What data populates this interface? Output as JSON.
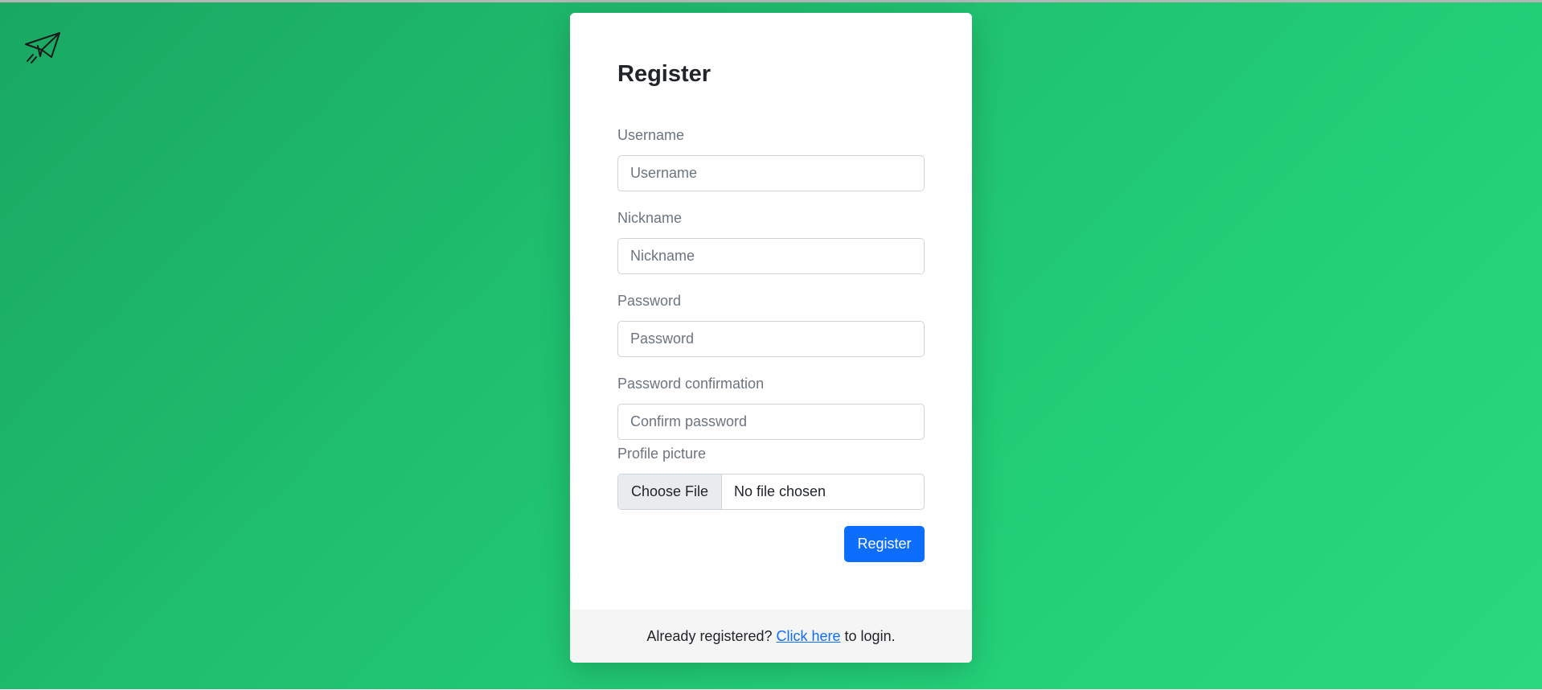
{
  "brand": {
    "icon": "paper-plane-icon"
  },
  "form": {
    "title": "Register",
    "username": {
      "label": "Username",
      "placeholder": "Username",
      "value": ""
    },
    "nickname": {
      "label": "Nickname",
      "placeholder": "Nickname",
      "value": ""
    },
    "password": {
      "label": "Password",
      "placeholder": "Password",
      "value": ""
    },
    "password_confirmation": {
      "label": "Password confirmation",
      "placeholder": "Confirm password",
      "value": ""
    },
    "profile_picture": {
      "label": "Profile picture",
      "button_label": "Choose File",
      "status": "No file chosen"
    },
    "submit_label": "Register"
  },
  "footer": {
    "prefix": "Already registered?",
    "link_text": "Click here",
    "suffix": "to login."
  },
  "colors": {
    "background_start": "#19a862",
    "background_end": "#2bd880",
    "primary": "#0d6efd"
  }
}
